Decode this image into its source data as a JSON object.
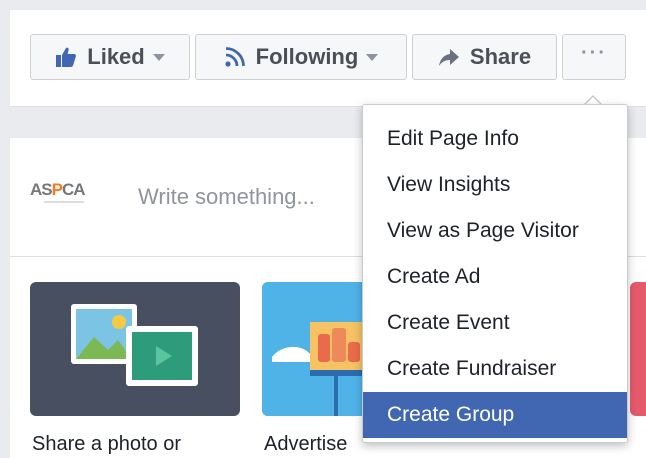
{
  "action_bar": {
    "liked_label": "Liked",
    "following_label": "Following",
    "share_label": "Share",
    "more_label": "···"
  },
  "composer": {
    "logo_text_a": "AS",
    "logo_text_b": "P",
    "logo_text_c": "CA",
    "placeholder": "Write something..."
  },
  "tiles": {
    "photo_caption": "Share a photo or",
    "advert_caption": "Advertise"
  },
  "menu": {
    "items": [
      {
        "label": "Edit Page Info"
      },
      {
        "label": "View Insights"
      },
      {
        "label": "View as Page Visitor"
      },
      {
        "label": "Create Ad"
      },
      {
        "label": "Create Event"
      },
      {
        "label": "Create Fundraiser"
      },
      {
        "label": "Create Group"
      }
    ],
    "active_item": "Create Group"
  },
  "colors": {
    "brand": "#4267b2",
    "thumb_icon": "#4267b2"
  },
  "icons": {
    "liked": "thumbs-up-icon",
    "following": "rss-icon",
    "share": "share-arrow-icon",
    "more": "more-dots-icon",
    "caret": "caret-down-icon"
  }
}
